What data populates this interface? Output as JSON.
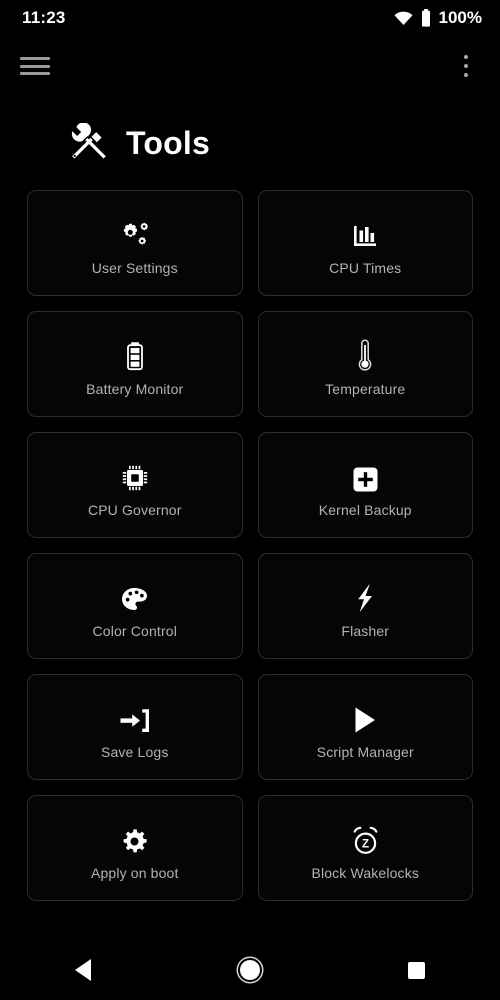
{
  "status_bar": {
    "time": "11:23",
    "battery_percent": "100%",
    "wifi_icon": "wifi-icon",
    "battery_icon": "battery-full-icon"
  },
  "app_bar": {
    "menu_icon": "hamburger-menu-icon",
    "overflow_icon": "overflow-menu-icon"
  },
  "header": {
    "title": "Tools",
    "title_icon": "tools-hammer-wrench-icon"
  },
  "colors": {
    "background": "#000000",
    "card_border": "#2c2c2c",
    "label_text": "#b3b3b3",
    "icon": "#ffffff",
    "status_text": "#ffffff"
  },
  "grid": {
    "items": [
      {
        "label": "User Settings",
        "icon": "gears-icon"
      },
      {
        "label": "CPU Times",
        "icon": "bar-chart-icon"
      },
      {
        "label": "Battery Monitor",
        "icon": "battery-icon"
      },
      {
        "label": "Temperature",
        "icon": "thermometer-icon"
      },
      {
        "label": "CPU Governor",
        "icon": "microchip-icon"
      },
      {
        "label": "Kernel Backup",
        "icon": "plus-square-icon"
      },
      {
        "label": "Color Control",
        "icon": "palette-icon"
      },
      {
        "label": "Flasher",
        "icon": "lightning-bolt-icon"
      },
      {
        "label": "Save Logs",
        "icon": "sign-in-arrow-icon"
      },
      {
        "label": "Script Manager",
        "icon": "play-triangle-icon"
      },
      {
        "label": "Apply on boot",
        "icon": "gear-icon"
      },
      {
        "label": "Block Wakelocks",
        "icon": "alarm-clock-z-icon"
      }
    ]
  },
  "nav_bar": {
    "back_label": "Back",
    "home_label": "Home",
    "recents_label": "Recents"
  }
}
